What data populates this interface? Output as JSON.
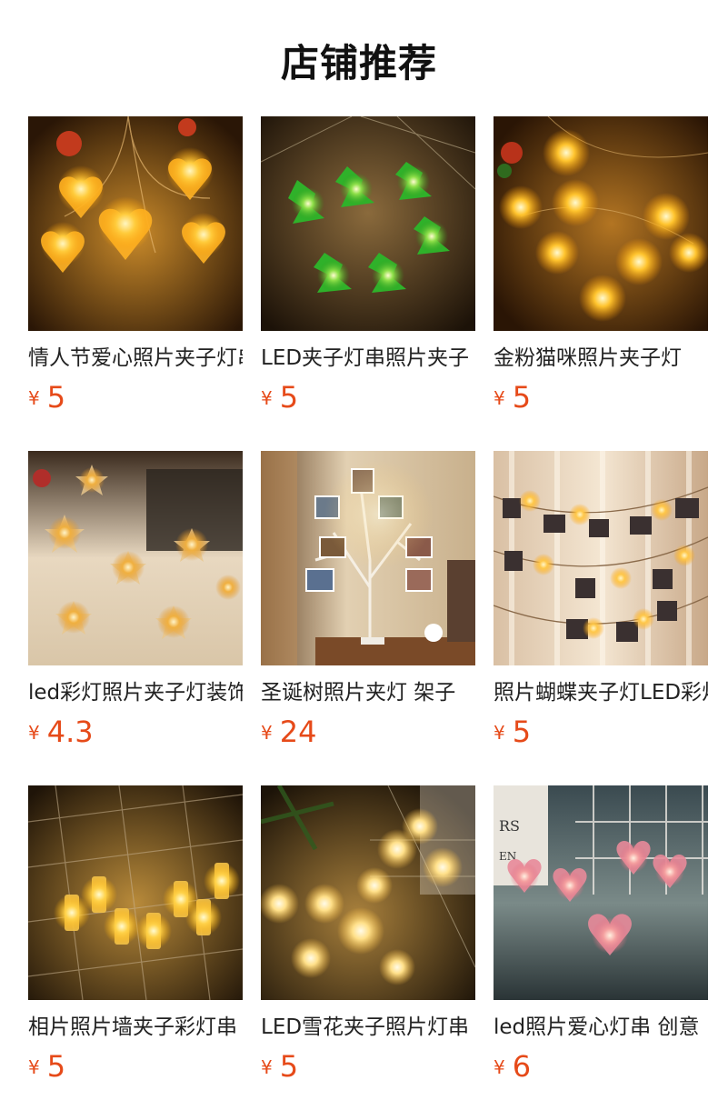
{
  "section_title": "店铺推荐",
  "colors": {
    "price": "#e64a19",
    "title": "#111111"
  },
  "products": [
    {
      "name": "情人节爱心照片夹子灯串",
      "currency": "¥",
      "price": "5",
      "image_icon": "heart-lights-image"
    },
    {
      "name": "LED夹子灯串照片夹子",
      "currency": "¥",
      "price": "5",
      "image_icon": "green-tree-lights-image"
    },
    {
      "name": "金粉猫咪照片夹子灯",
      "currency": "¥",
      "price": "5",
      "image_icon": "cat-lights-image"
    },
    {
      "name": "led彩灯照片夹子灯装饰",
      "currency": "¥",
      "price": "4.3",
      "image_icon": "star-lights-image"
    },
    {
      "name": "圣诞树照片夹灯 架子",
      "currency": "¥",
      "price": "24",
      "image_icon": "photo-tree-image"
    },
    {
      "name": "照片蝴蝶夹子灯LED彩灯",
      "currency": "¥",
      "price": "5",
      "image_icon": "butterfly-clip-lights-image"
    },
    {
      "name": "相片照片墙夹子彩灯串",
      "currency": "¥",
      "price": "5",
      "image_icon": "clip-lights-image"
    },
    {
      "name": "LED雪花夹子照片灯串",
      "currency": "¥",
      "price": "5",
      "image_icon": "snowflake-lights-image"
    },
    {
      "name": "led照片爱心灯串 创意",
      "currency": "¥",
      "price": "6",
      "image_icon": "pink-heart-lights-image"
    }
  ]
}
